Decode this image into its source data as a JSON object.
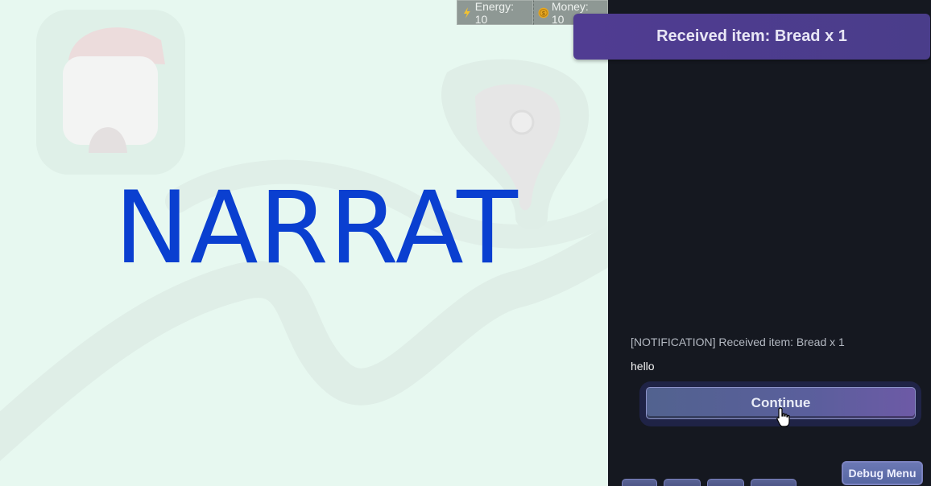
{
  "game": {
    "logo_text": "NARRAT"
  },
  "hud": {
    "stats": [
      {
        "label": "Energy: 10",
        "icon": "lightning-icon",
        "color": "#f2c230"
      },
      {
        "label": "Money: 10",
        "icon": "coin-icon",
        "color": "#e8a820"
      }
    ]
  },
  "notification": {
    "toast_text": "Received item: Bread x 1"
  },
  "dialog": {
    "lines": [
      "[NOTIFICATION] Received item: Bread x 1",
      "hello"
    ],
    "continue_label": "Continue"
  },
  "debug": {
    "button_label": "Debug Menu"
  },
  "colors": {
    "viewport_bg": "#e7f8f0",
    "sidebar_bg": "#151820",
    "logo": "#0a3fd0",
    "accent_purple": "#503c92"
  }
}
